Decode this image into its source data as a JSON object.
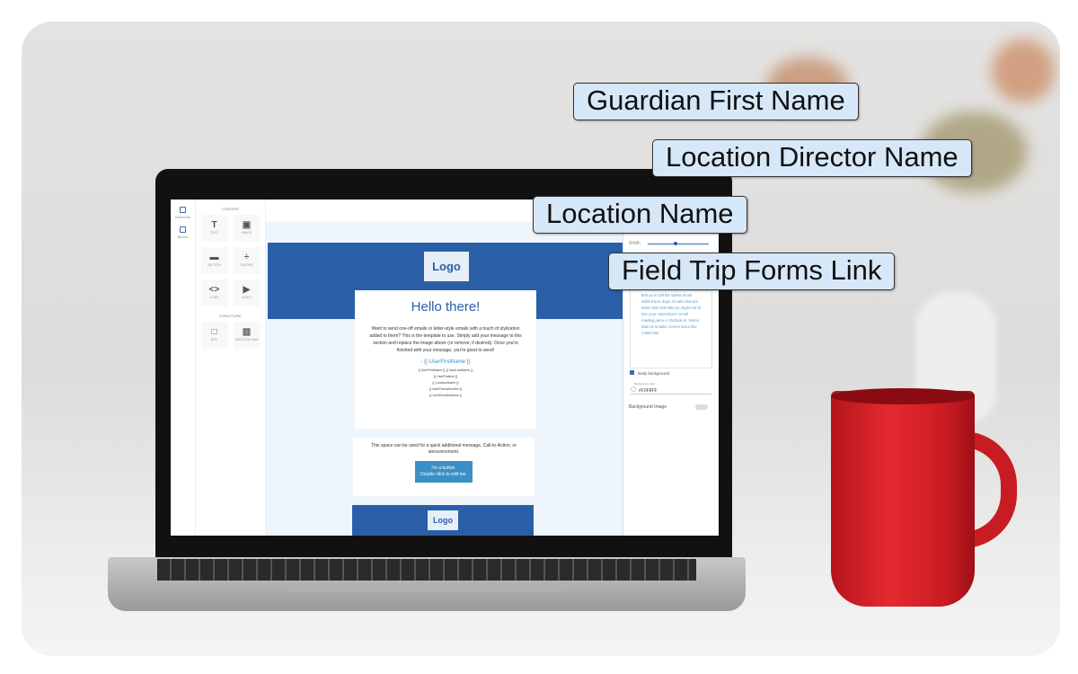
{
  "labels": [
    "Guardian First Name",
    "Location Director Name",
    "Location Name",
    "Field Trip Forms Link"
  ],
  "editor": {
    "tabs": [
      {
        "label": "Elements",
        "icon": "elements-icon"
      },
      {
        "label": "Blocks",
        "icon": "blocks-icon"
      }
    ],
    "content_heading": "CONTENT",
    "content_items": [
      {
        "label": "TEXT",
        "icon": "T"
      },
      {
        "label": "IMAGE",
        "icon": "▣"
      },
      {
        "label": "BUTTON",
        "icon": "▬"
      },
      {
        "label": "DIVIDER",
        "icon": "÷"
      },
      {
        "label": "CODE",
        "icon": "<>"
      },
      {
        "label": "VIDEO",
        "icon": "▶"
      }
    ],
    "structure_heading": "STRUCTURE",
    "structure_items": [
      {
        "label": "BOX",
        "icon": "□"
      },
      {
        "label": "MULTICOLUMN",
        "icon": "▥"
      }
    ],
    "email": {
      "logo": "Logo",
      "heading": "Hello there!",
      "body": "Want to send one-off emails or letter-style emails with a touch of stylization added to them? This is the template to use. Simply add your message to this section and replace the image above (or remove, if desired). Once you're finished with your message, you're good to send!",
      "signature": "- {{ UserFirstName }}",
      "tokens": [
        "{{ UserFirstName }} {{ UserLastName }}",
        "{{ UserPosition }}",
        "{{ LocationName }}",
        "{{ UserPhoneNumber }}",
        "{{ UserEmailAddress }}"
      ],
      "secondary": "This space can be used for a quick additional message, Call-to-Action, or announcement.",
      "button": [
        "I'm a button.",
        "Double click to edit me."
      ],
      "footer_logo": "Logo"
    },
    "panel": {
      "width_label": "Width",
      "width_value": 0.5,
      "info": "600 px is still the safest email width these days. Emails that are wider than 600-650 px might not fit into your subscribers' email reading pane in Outlook or Yahoo Mail on smaller screen sizes like 1366x768.",
      "body_bg_label": "Body background",
      "bg_color_label": "Background color",
      "bg_color_value": "#F0F8FF",
      "bg_image_label": "Background Image",
      "bg_image_on": false
    }
  },
  "colors": {
    "brand": "#2a5fa8",
    "canvas": "#eef6fb",
    "label_bg": "#d6e8f8",
    "mug": "#d32027"
  }
}
